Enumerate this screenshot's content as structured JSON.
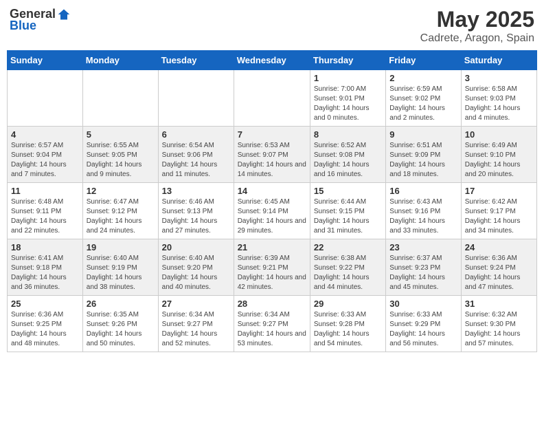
{
  "header": {
    "logo_general": "General",
    "logo_blue": "Blue",
    "month_title": "May 2025",
    "location": "Cadrete, Aragon, Spain"
  },
  "days_of_week": [
    "Sunday",
    "Monday",
    "Tuesday",
    "Wednesday",
    "Thursday",
    "Friday",
    "Saturday"
  ],
  "weeks": [
    [
      {
        "day": "",
        "sunrise": "",
        "sunset": "",
        "daylight": ""
      },
      {
        "day": "",
        "sunrise": "",
        "sunset": "",
        "daylight": ""
      },
      {
        "day": "",
        "sunrise": "",
        "sunset": "",
        "daylight": ""
      },
      {
        "day": "",
        "sunrise": "",
        "sunset": "",
        "daylight": ""
      },
      {
        "day": "1",
        "sunrise": "Sunrise: 7:00 AM",
        "sunset": "Sunset: 9:01 PM",
        "daylight": "Daylight: 14 hours and 0 minutes."
      },
      {
        "day": "2",
        "sunrise": "Sunrise: 6:59 AM",
        "sunset": "Sunset: 9:02 PM",
        "daylight": "Daylight: 14 hours and 2 minutes."
      },
      {
        "day": "3",
        "sunrise": "Sunrise: 6:58 AM",
        "sunset": "Sunset: 9:03 PM",
        "daylight": "Daylight: 14 hours and 4 minutes."
      }
    ],
    [
      {
        "day": "4",
        "sunrise": "Sunrise: 6:57 AM",
        "sunset": "Sunset: 9:04 PM",
        "daylight": "Daylight: 14 hours and 7 minutes."
      },
      {
        "day": "5",
        "sunrise": "Sunrise: 6:55 AM",
        "sunset": "Sunset: 9:05 PM",
        "daylight": "Daylight: 14 hours and 9 minutes."
      },
      {
        "day": "6",
        "sunrise": "Sunrise: 6:54 AM",
        "sunset": "Sunset: 9:06 PM",
        "daylight": "Daylight: 14 hours and 11 minutes."
      },
      {
        "day": "7",
        "sunrise": "Sunrise: 6:53 AM",
        "sunset": "Sunset: 9:07 PM",
        "daylight": "Daylight: 14 hours and 14 minutes."
      },
      {
        "day": "8",
        "sunrise": "Sunrise: 6:52 AM",
        "sunset": "Sunset: 9:08 PM",
        "daylight": "Daylight: 14 hours and 16 minutes."
      },
      {
        "day": "9",
        "sunrise": "Sunrise: 6:51 AM",
        "sunset": "Sunset: 9:09 PM",
        "daylight": "Daylight: 14 hours and 18 minutes."
      },
      {
        "day": "10",
        "sunrise": "Sunrise: 6:49 AM",
        "sunset": "Sunset: 9:10 PM",
        "daylight": "Daylight: 14 hours and 20 minutes."
      }
    ],
    [
      {
        "day": "11",
        "sunrise": "Sunrise: 6:48 AM",
        "sunset": "Sunset: 9:11 PM",
        "daylight": "Daylight: 14 hours and 22 minutes."
      },
      {
        "day": "12",
        "sunrise": "Sunrise: 6:47 AM",
        "sunset": "Sunset: 9:12 PM",
        "daylight": "Daylight: 14 hours and 24 minutes."
      },
      {
        "day": "13",
        "sunrise": "Sunrise: 6:46 AM",
        "sunset": "Sunset: 9:13 PM",
        "daylight": "Daylight: 14 hours and 27 minutes."
      },
      {
        "day": "14",
        "sunrise": "Sunrise: 6:45 AM",
        "sunset": "Sunset: 9:14 PM",
        "daylight": "Daylight: 14 hours and 29 minutes."
      },
      {
        "day": "15",
        "sunrise": "Sunrise: 6:44 AM",
        "sunset": "Sunset: 9:15 PM",
        "daylight": "Daylight: 14 hours and 31 minutes."
      },
      {
        "day": "16",
        "sunrise": "Sunrise: 6:43 AM",
        "sunset": "Sunset: 9:16 PM",
        "daylight": "Daylight: 14 hours and 33 minutes."
      },
      {
        "day": "17",
        "sunrise": "Sunrise: 6:42 AM",
        "sunset": "Sunset: 9:17 PM",
        "daylight": "Daylight: 14 hours and 34 minutes."
      }
    ],
    [
      {
        "day": "18",
        "sunrise": "Sunrise: 6:41 AM",
        "sunset": "Sunset: 9:18 PM",
        "daylight": "Daylight: 14 hours and 36 minutes."
      },
      {
        "day": "19",
        "sunrise": "Sunrise: 6:40 AM",
        "sunset": "Sunset: 9:19 PM",
        "daylight": "Daylight: 14 hours and 38 minutes."
      },
      {
        "day": "20",
        "sunrise": "Sunrise: 6:40 AM",
        "sunset": "Sunset: 9:20 PM",
        "daylight": "Daylight: 14 hours and 40 minutes."
      },
      {
        "day": "21",
        "sunrise": "Sunrise: 6:39 AM",
        "sunset": "Sunset: 9:21 PM",
        "daylight": "Daylight: 14 hours and 42 minutes."
      },
      {
        "day": "22",
        "sunrise": "Sunrise: 6:38 AM",
        "sunset": "Sunset: 9:22 PM",
        "daylight": "Daylight: 14 hours and 44 minutes."
      },
      {
        "day": "23",
        "sunrise": "Sunrise: 6:37 AM",
        "sunset": "Sunset: 9:23 PM",
        "daylight": "Daylight: 14 hours and 45 minutes."
      },
      {
        "day": "24",
        "sunrise": "Sunrise: 6:36 AM",
        "sunset": "Sunset: 9:24 PM",
        "daylight": "Daylight: 14 hours and 47 minutes."
      }
    ],
    [
      {
        "day": "25",
        "sunrise": "Sunrise: 6:36 AM",
        "sunset": "Sunset: 9:25 PM",
        "daylight": "Daylight: 14 hours and 48 minutes."
      },
      {
        "day": "26",
        "sunrise": "Sunrise: 6:35 AM",
        "sunset": "Sunset: 9:26 PM",
        "daylight": "Daylight: 14 hours and 50 minutes."
      },
      {
        "day": "27",
        "sunrise": "Sunrise: 6:34 AM",
        "sunset": "Sunset: 9:27 PM",
        "daylight": "Daylight: 14 hours and 52 minutes."
      },
      {
        "day": "28",
        "sunrise": "Sunrise: 6:34 AM",
        "sunset": "Sunset: 9:27 PM",
        "daylight": "Daylight: 14 hours and 53 minutes."
      },
      {
        "day": "29",
        "sunrise": "Sunrise: 6:33 AM",
        "sunset": "Sunset: 9:28 PM",
        "daylight": "Daylight: 14 hours and 54 minutes."
      },
      {
        "day": "30",
        "sunrise": "Sunrise: 6:33 AM",
        "sunset": "Sunset: 9:29 PM",
        "daylight": "Daylight: 14 hours and 56 minutes."
      },
      {
        "day": "31",
        "sunrise": "Sunrise: 6:32 AM",
        "sunset": "Sunset: 9:30 PM",
        "daylight": "Daylight: 14 hours and 57 minutes."
      }
    ]
  ]
}
